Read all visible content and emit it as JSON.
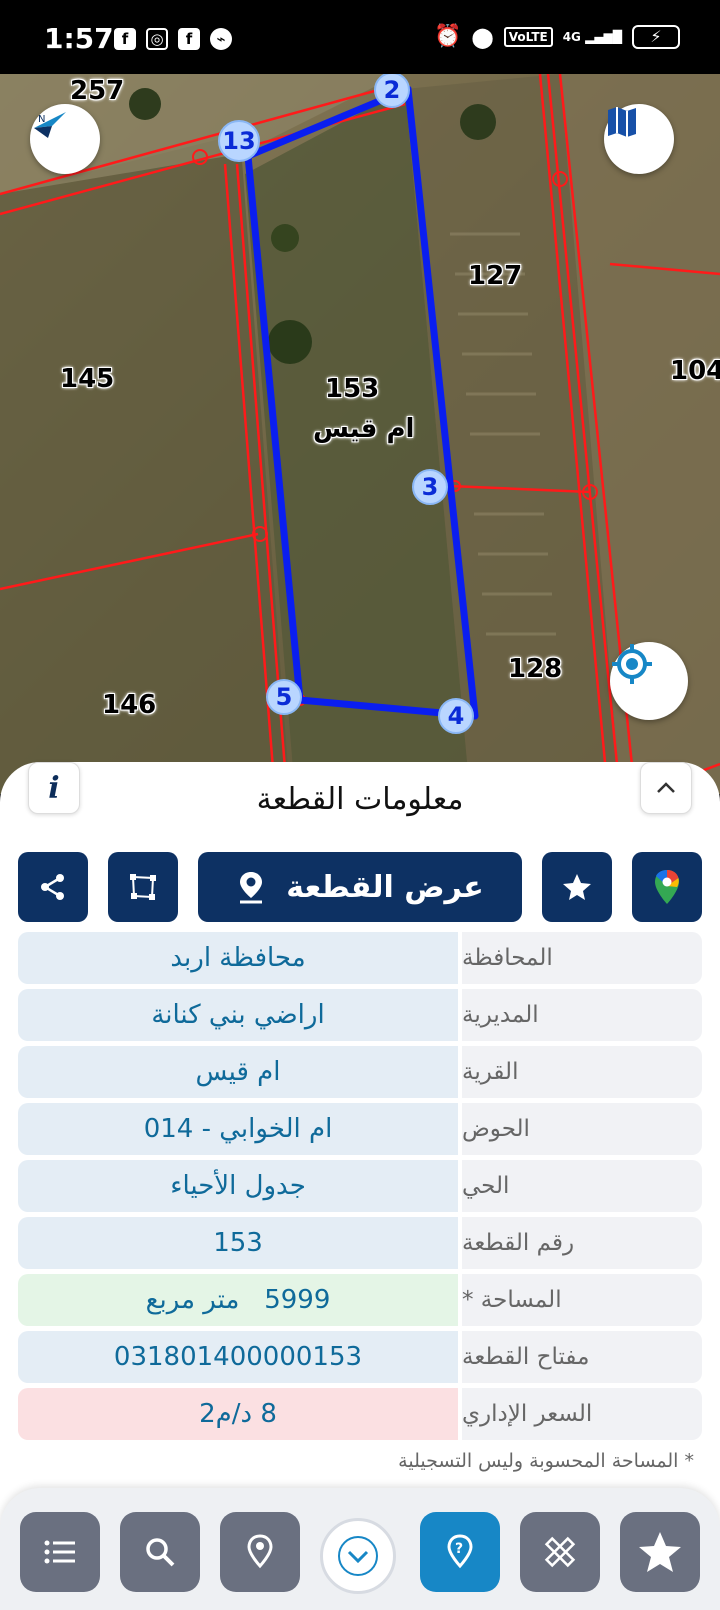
{
  "status_bar": {
    "time": "1:57",
    "left_icons": [
      "facebook-icon",
      "instagram-icon",
      "facebook-icon",
      "messenger-icon"
    ],
    "right_icons": [
      "alarm-icon",
      "location-icon",
      "volte-icon",
      "signal-4g-icon",
      "battery-charging-icon"
    ],
    "volte": "VoLTE",
    "network": "4G"
  },
  "map": {
    "parcel_labels": {
      "p257": "257",
      "p127": "127",
      "p145": "145",
      "p104": "104",
      "p153": "153",
      "village": "ام قيس",
      "p128": "128",
      "p146": "146"
    },
    "vertices": [
      "2",
      "13",
      "3",
      "5",
      "4"
    ],
    "colors": {
      "parcel_outline": "#0a1ef0",
      "cadastral_lines": "#ff1a1a"
    }
  },
  "panel": {
    "title": "معلومات القطعة",
    "info_button": "i",
    "show_parcel_button": "عرض القطعة",
    "rows": [
      {
        "key": "المحافظة",
        "value": "محافظة اربد"
      },
      {
        "key": "المديرية",
        "value": "اراضي بني كنانة"
      },
      {
        "key": "القرية",
        "value": "ام قيس"
      },
      {
        "key": "الحوض",
        "value": "ام الخوابي - 014"
      },
      {
        "key": "الحي",
        "value": "جدول الأحياء"
      },
      {
        "key": "رقم القطعة",
        "value": "153"
      },
      {
        "key": "المساحة *",
        "value": "5999   متر مربع"
      },
      {
        "key": "مفتاح القطعة",
        "value": "031801400000153"
      },
      {
        "key": "السعر الإداري",
        "value": "8 د/م2"
      }
    ],
    "footnote": "* المساحة المحسوبة وليس التسجيلية"
  },
  "bottom_bar": {
    "buttons": [
      "list-icon",
      "search-icon",
      "location-pin-icon",
      "chevron-down-icon",
      "help-location-icon",
      "ruler-tools-icon",
      "star-icon"
    ]
  },
  "colors": {
    "primary_dark": "#0d3163",
    "accent_blue": "#1787c6",
    "value_text": "#0f6a9a",
    "area_bg": "#e4f5e6",
    "price_bg": "#fbe0e2"
  }
}
